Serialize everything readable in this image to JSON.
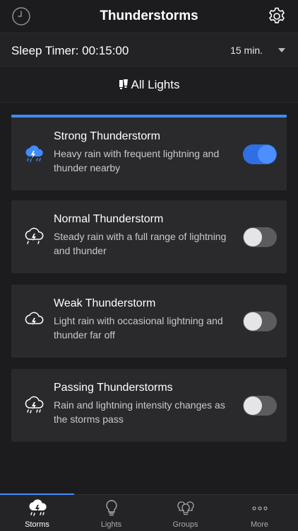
{
  "header": {
    "title": "Thunderstorms",
    "left_icon": "clock-icon",
    "right_icon": "gear-icon"
  },
  "sleep_timer": {
    "label": "Sleep Timer: 00:15:00",
    "selected": "15 min."
  },
  "lights": {
    "label": "All Lights",
    "icon": "lights-icon"
  },
  "storms": [
    {
      "name": "Strong Thunderstorm",
      "description": "Heavy rain with frequent lightning and thunder nearby",
      "enabled": true,
      "icon": "storm-cloud-icon"
    },
    {
      "name": "Normal Thunderstorm",
      "description": "Steady rain with a full range of lightning and thunder",
      "enabled": false,
      "icon": "storm-cloud-icon"
    },
    {
      "name": "Weak Thunderstorm",
      "description": "Light rain with occasional lightning and thunder far off",
      "enabled": false,
      "icon": "lightning-cloud-icon"
    },
    {
      "name": "Passing Thunderstorms",
      "description": "Rain and lightning intensity changes as the storms pass",
      "enabled": false,
      "icon": "storm-cloud-icon"
    }
  ],
  "tabs": [
    {
      "label": "Storms",
      "icon": "storm-cloud-icon",
      "active": true
    },
    {
      "label": "Lights",
      "icon": "bulb-icon",
      "active": false
    },
    {
      "label": "Groups",
      "icon": "bulbs-group-icon",
      "active": false
    },
    {
      "label": "More",
      "icon": "more-dots-icon",
      "active": false
    }
  ],
  "colors": {
    "accent": "#3f8cff",
    "background": "#1c1c1e",
    "card": "#2a2a2d",
    "toggle_on": "#2f6fe3"
  }
}
